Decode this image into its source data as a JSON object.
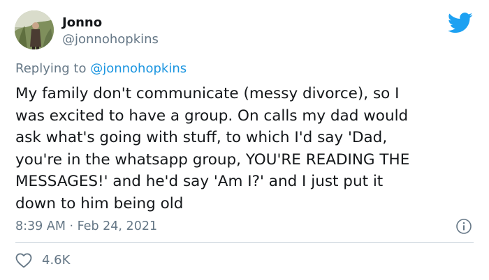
{
  "author": {
    "display_name": "Jonno",
    "handle": "@jonnohopkins"
  },
  "reply": {
    "prefix": "Replying to",
    "mention": "@jonnohopkins"
  },
  "tweet": {
    "lines": [
      "My family don't communicate (messy divorce), so I",
      "was excited to have a group. On calls my dad would",
      "ask what's going with stuff, to which I'd say 'Dad,",
      "you're in the whatsapp group, YOU'RE READING THE",
      "MESSAGES!' and he'd say 'Am I?' and I just put it",
      "down to him being old"
    ],
    "timestamp": "8:39 AM · Feb 24, 2021"
  },
  "engagement": {
    "likes": "4.6K"
  },
  "icons": {
    "brand": "twitter-bird-icon",
    "info": "info-icon",
    "like": "heart-icon"
  },
  "colors": {
    "brand_blue": "#1da1f2",
    "link_blue": "#1b95e0",
    "secondary_text": "#657786",
    "primary_text": "#14171a",
    "divider": "#ccd6dd"
  }
}
